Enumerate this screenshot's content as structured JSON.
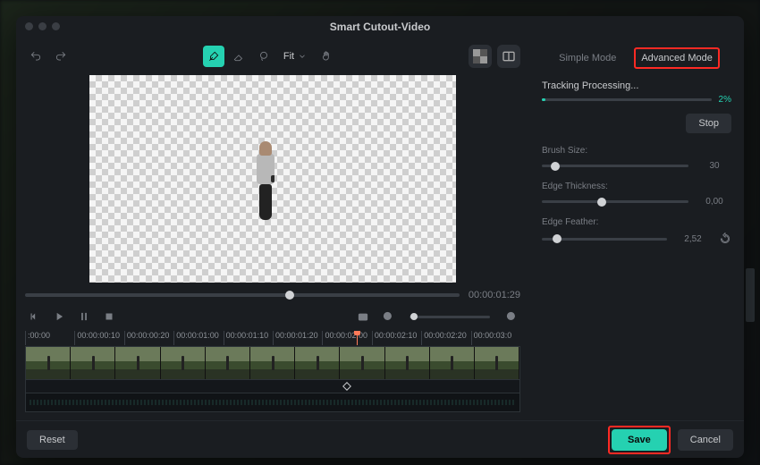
{
  "title": "Smart Cutout-Video",
  "toolbar": {
    "fit_label": "Fit"
  },
  "preview": {
    "seek_position_pct": 61,
    "time_readout": "00:00:01:29"
  },
  "zoom": {
    "position_pct": 5
  },
  "ruler_marks": [
    ":00:00",
    "00:00:00:10",
    "00:00:00:20",
    "00:00:01:00",
    "00:00:01:10",
    "00:00:01:20",
    "00:00:02:00",
    "00:00:02:10",
    "00:00:02:20",
    "00:00:03:0"
  ],
  "playhead_pct": 67,
  "keyframe_pct": 65,
  "modes": {
    "simple": "Simple Mode",
    "advanced": "Advanced Mode"
  },
  "tracking": {
    "label": "Tracking Processing...",
    "percent_label": "2%",
    "percent_value": 2,
    "stop_label": "Stop"
  },
  "params": {
    "brush": {
      "label": "Brush Size:",
      "value": "30",
      "pos_pct": 9
    },
    "edge_thickness": {
      "label": "Edge Thickness:",
      "value": "0,00",
      "pos_pct": 41
    },
    "edge_feather": {
      "label": "Edge Feather:",
      "value": "2,52",
      "pos_pct": 12
    }
  },
  "footer": {
    "reset": "Reset",
    "save": "Save",
    "cancel": "Cancel"
  }
}
